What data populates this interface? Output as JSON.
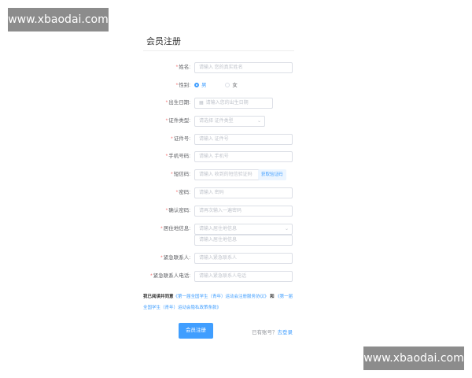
{
  "watermarks": [
    "www.xbaodai.com",
    "www.xbaodai.com"
  ],
  "title": "会员注册",
  "form": {
    "name": {
      "label": "姓名:",
      "placeholder": "请输入 您的真实姓名"
    },
    "gender": {
      "label": "性别:",
      "options": [
        "男",
        "女"
      ],
      "selected": "男"
    },
    "birthday": {
      "label": "出生日期:",
      "placeholder": "请输入您的出生日期"
    },
    "id_type": {
      "label": "证件类型:",
      "placeholder": "请选择 证件类型"
    },
    "id_number": {
      "label": "证件号:",
      "placeholder": "请输入 证件号"
    },
    "phone": {
      "label": "手机号码:",
      "placeholder": "请输入 手机号"
    },
    "sms_code": {
      "label": "短信码:",
      "placeholder": "请输入 收到的短信验证码",
      "button": "获取验证码"
    },
    "password": {
      "label": "密码:",
      "placeholder": "请输入 密码"
    },
    "confirm_password": {
      "label": "确认密码:",
      "placeholder": "请再次输入一遍密码"
    },
    "address": {
      "label": "居住地信息:",
      "region_placeholder": "请输入居住地信息",
      "detail_placeholder": "请输入居住地信息"
    },
    "emergency_contact": {
      "label": "紧急联系人:",
      "placeholder": "请输入紧急联系人"
    },
    "emergency_phone": {
      "label": "紧急联系人电话:",
      "placeholder": "请输入紧急联系人电话"
    }
  },
  "agreement": {
    "prefix": "我已阅读并同意",
    "link1": "《第一届全国学生（青年）运动会注册服务协议》",
    "and": "和",
    "link2": "《第一届全国学生（青年）运动会隐私政策条款》"
  },
  "submit_label": "会员注册",
  "login_hint": {
    "text": "已有账号？",
    "link": "去登录"
  }
}
